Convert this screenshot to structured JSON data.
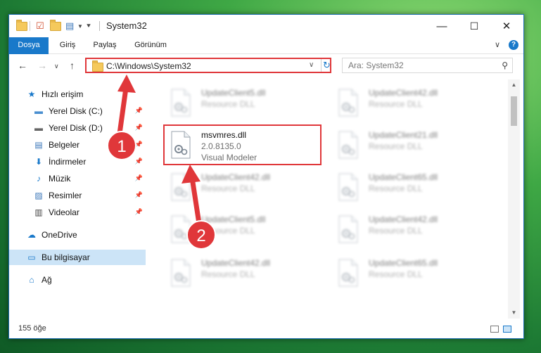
{
  "window": {
    "title": "System32",
    "minimize": "—",
    "maximize": "☐",
    "close": "✕"
  },
  "ribbon": {
    "tabs": [
      "Dosya",
      "Giriş",
      "Paylaş",
      "Görünüm"
    ],
    "expand": "∨",
    "help": "?"
  },
  "address": {
    "path": "C:\\Windows\\System32",
    "dropdown": "∨",
    "refresh": "↻"
  },
  "search": {
    "placeholder": "Ara: System32"
  },
  "nav": {
    "back": "←",
    "forward": "→",
    "recent": "∨",
    "up": "↑",
    "items": [
      {
        "label": "Hızlı erişim",
        "icon": "star-icon",
        "glyph": "★",
        "color": "#1979ca",
        "pinned": false
      },
      {
        "label": "Yerel Disk (C:)",
        "icon": "drive-icon",
        "glyph": "▬",
        "color": "#4a8fd0",
        "pinned": true
      },
      {
        "label": "Yerel Disk (D:)",
        "icon": "drive-icon",
        "glyph": "▬",
        "color": "#666666",
        "pinned": true
      },
      {
        "label": "Belgeler",
        "icon": "documents-icon",
        "glyph": "▤",
        "color": "#3a76b8",
        "pinned": true
      },
      {
        "label": "İndirmeler",
        "icon": "download-icon",
        "glyph": "⬇",
        "color": "#1979ca",
        "pinned": true
      },
      {
        "label": "Müzik",
        "icon": "music-icon",
        "glyph": "♪",
        "color": "#1979ca",
        "pinned": true
      },
      {
        "label": "Resimler",
        "icon": "pictures-icon",
        "glyph": "▨",
        "color": "#3a76b8",
        "pinned": true
      },
      {
        "label": "Videolar",
        "icon": "videos-icon",
        "glyph": "▥",
        "color": "#444444",
        "pinned": true
      },
      {
        "label": "OneDrive",
        "icon": "cloud-icon",
        "glyph": "☁",
        "color": "#1979ca",
        "pinned": false
      },
      {
        "label": "Bu bilgisayar",
        "icon": "computer-icon",
        "glyph": "▭",
        "color": "#1979ca",
        "pinned": false
      },
      {
        "label": "Ağ",
        "icon": "network-icon",
        "glyph": "⌂",
        "color": "#1979ca",
        "pinned": false
      }
    ]
  },
  "files": [
    {
      "name": "UpdateClient5.dll",
      "sub": "Resource DLL",
      "blur": true
    },
    {
      "name": "UpdateClient42.dll",
      "sub": "Resource DLL",
      "blur": true
    },
    {
      "name": "msvmres.dll",
      "sub": "2.0.8135.0",
      "sub2": "Visual Modeler",
      "blur": false
    },
    {
      "name": "UpdateClient21.dll",
      "sub": "Resource DLL",
      "blur": true
    },
    {
      "name": "UpdateClient42.dll",
      "sub": "Resource DLL",
      "blur": true
    },
    {
      "name": "UpdateClient65.dll",
      "sub": "Resource DLL",
      "blur": true
    },
    {
      "name": "UpdateClient5.dll",
      "sub": "Resource DLL",
      "blur": true
    },
    {
      "name": "UpdateClient42.dll",
      "sub": "Resource DLL",
      "blur": true
    },
    {
      "name": "UpdateClient42.dll",
      "sub": "Resource DLL",
      "blur": true
    },
    {
      "name": "UpdateClient65.dll",
      "sub": "Resource DLL",
      "blur": true
    }
  ],
  "status": {
    "count": "155 öğe"
  },
  "annotations": {
    "step1": "1",
    "step2": "2",
    "color": "#e0373a"
  }
}
